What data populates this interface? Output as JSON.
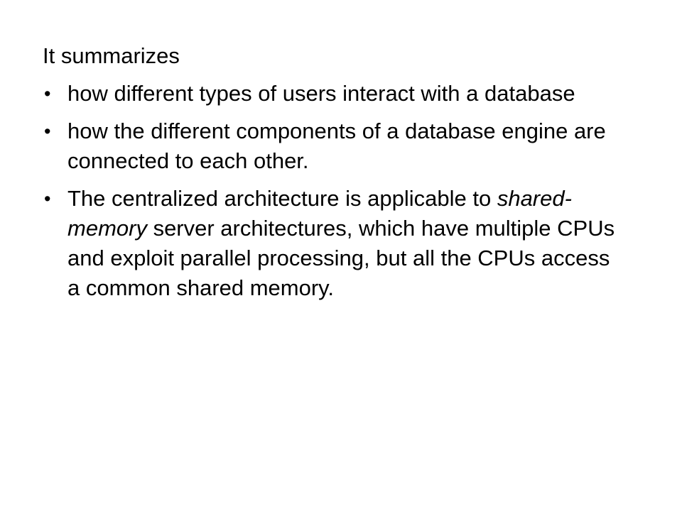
{
  "slide": {
    "intro": "It summarizes",
    "bullet_symbol": "•",
    "bullets": [
      {
        "text": "how different types of users interact with a database"
      },
      {
        "text": "how the different components of a database engine are connected to each other."
      },
      {
        "pre": "The centralized architecture is applicable to ",
        "emphasis": "shared-memory",
        "post": " server architectures, which have multiple CPUs and exploit parallel processing, but all the CPUs access a common shared memory."
      }
    ]
  }
}
